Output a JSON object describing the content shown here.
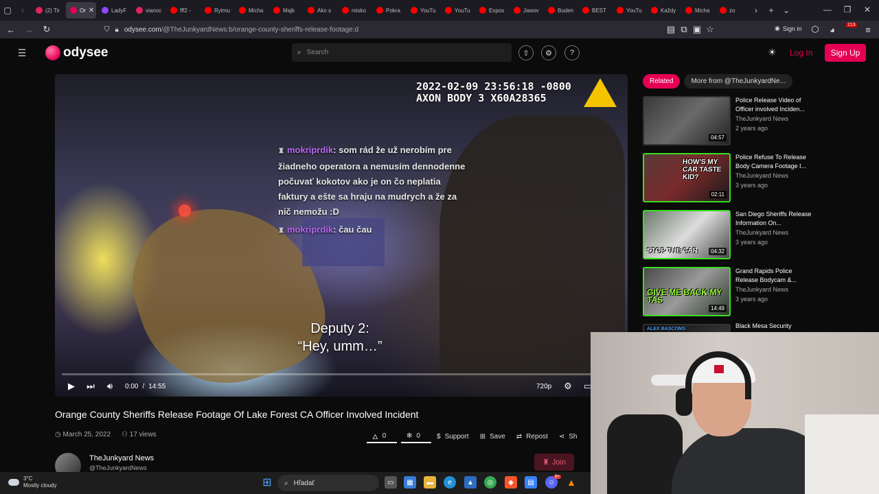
{
  "browser": {
    "tabs": [
      {
        "label": "(2) Tir",
        "color": "#e0245e"
      },
      {
        "label": "Or",
        "color": "#e50054",
        "active": true
      },
      {
        "label": "LadyF",
        "color": "#9146ff"
      },
      {
        "label": "vianoc",
        "color": "#e0245e"
      },
      {
        "label": "fff2 -",
        "color": "#ff0000"
      },
      {
        "label": "Rytmu",
        "color": "#ff0000"
      },
      {
        "label": "Micha",
        "color": "#ff0000"
      },
      {
        "label": "Majk",
        "color": "#ff0000"
      },
      {
        "label": "Ako s",
        "color": "#ff0000"
      },
      {
        "label": "misko",
        "color": "#ff0000"
      },
      {
        "label": "Pokra",
        "color": "#ff0000"
      },
      {
        "label": "YouTu",
        "color": "#ff0000"
      },
      {
        "label": "YouTu",
        "color": "#ff0000"
      },
      {
        "label": "Expos",
        "color": "#ff0000"
      },
      {
        "label": "Jawov",
        "color": "#ff0000"
      },
      {
        "label": "Buden",
        "color": "#ff0000"
      },
      {
        "label": "BEST",
        "color": "#ff0000"
      },
      {
        "label": "YouTu",
        "color": "#ff0000"
      },
      {
        "label": "Každy",
        "color": "#ff0000"
      },
      {
        "label": "Micha",
        "color": "#ff0000"
      },
      {
        "label": "zo",
        "color": "#ff0000"
      }
    ],
    "url_domain": "odysee.com",
    "url_path": "/@TheJunkyardNews:b/orange-county-sheriffs-release-footage:d",
    "sign_in": "Sign in",
    "badge_count": "213"
  },
  "header": {
    "logo_text": "odysee",
    "search_placeholder": "Search",
    "login": "Log In",
    "signup": "Sign Up"
  },
  "video": {
    "timestamp_line1": "2022-02-09 23:56:18 -0800",
    "timestamp_line2": "AXON BODY 3 X60A28365",
    "chat": [
      {
        "user": "mokriprdik",
        "message": ": som rád že už nerobím pre žiadneho operatora a nemusím dennodenne počuvať kokotov ako je on čo neplatia faktury a ešte sa hraju na mudrych a že za nič nemožu :D"
      },
      {
        "user": "mokriprdik",
        "message": ": čau čau"
      }
    ],
    "caption_line1": "Deputy 2:",
    "caption_line2": "“Hey, umm…”",
    "progress": 0,
    "time_current": "0:00",
    "time_separator": "/",
    "time_total": "14:55",
    "quality": "720p"
  },
  "details": {
    "title": "Orange County Sheriffs Release Footage Of Lake Forest CA Officer Involved Incident",
    "date": "March 25, 2022",
    "views": "17 views",
    "fire_count": "0",
    "slime_count": "0",
    "support": "Support",
    "save": "Save",
    "repost": "Repost",
    "share": "Sh",
    "channel_name": "TheJunkyard News",
    "channel_handle": "@TheJunkyardNews",
    "join": "Join"
  },
  "related": {
    "tab_related": "Related",
    "tab_more": "More from @TheJunkyardNe...",
    "items": [
      {
        "title": "Police Release Video of Officer involved Inciden...",
        "channel": "TheJunkyard News",
        "age": "2 years ago",
        "duration": "04:57",
        "thumb_text": "",
        "border": "#333333"
      },
      {
        "title": "Police Refuse To Release Body Camera Footage I...",
        "channel": "TheJunkyard News",
        "age": "3 years ago",
        "duration": "02:11",
        "thumb_text": "HOW'S MY CAR TASTE KID?",
        "border": "#39e020"
      },
      {
        "title": "San Diego Sheriffs Release Information On...",
        "channel": "TheJunkyard News",
        "age": "3 years ago",
        "duration": "04:32",
        "thumb_text": "STOP THE CAR",
        "border": "#39e020"
      },
      {
        "title": "Grand Rapids Police Release Bodycam &...",
        "channel": "TheJunkyard News",
        "age": "3 years ago",
        "duration": "14:49",
        "thumb_text": "GIVE ME BACK MY TAS",
        "border": "#39e020"
      },
      {
        "title": "Black Mesa Security",
        "channel": "",
        "age": "",
        "duration": "",
        "thumb_text": "ALEX BASCOMS",
        "border": "#333333"
      }
    ]
  },
  "taskbar": {
    "temperature": "3°C",
    "weather": "Mostly cloudy",
    "search": "Hľadať",
    "discord_badge": "9+"
  }
}
